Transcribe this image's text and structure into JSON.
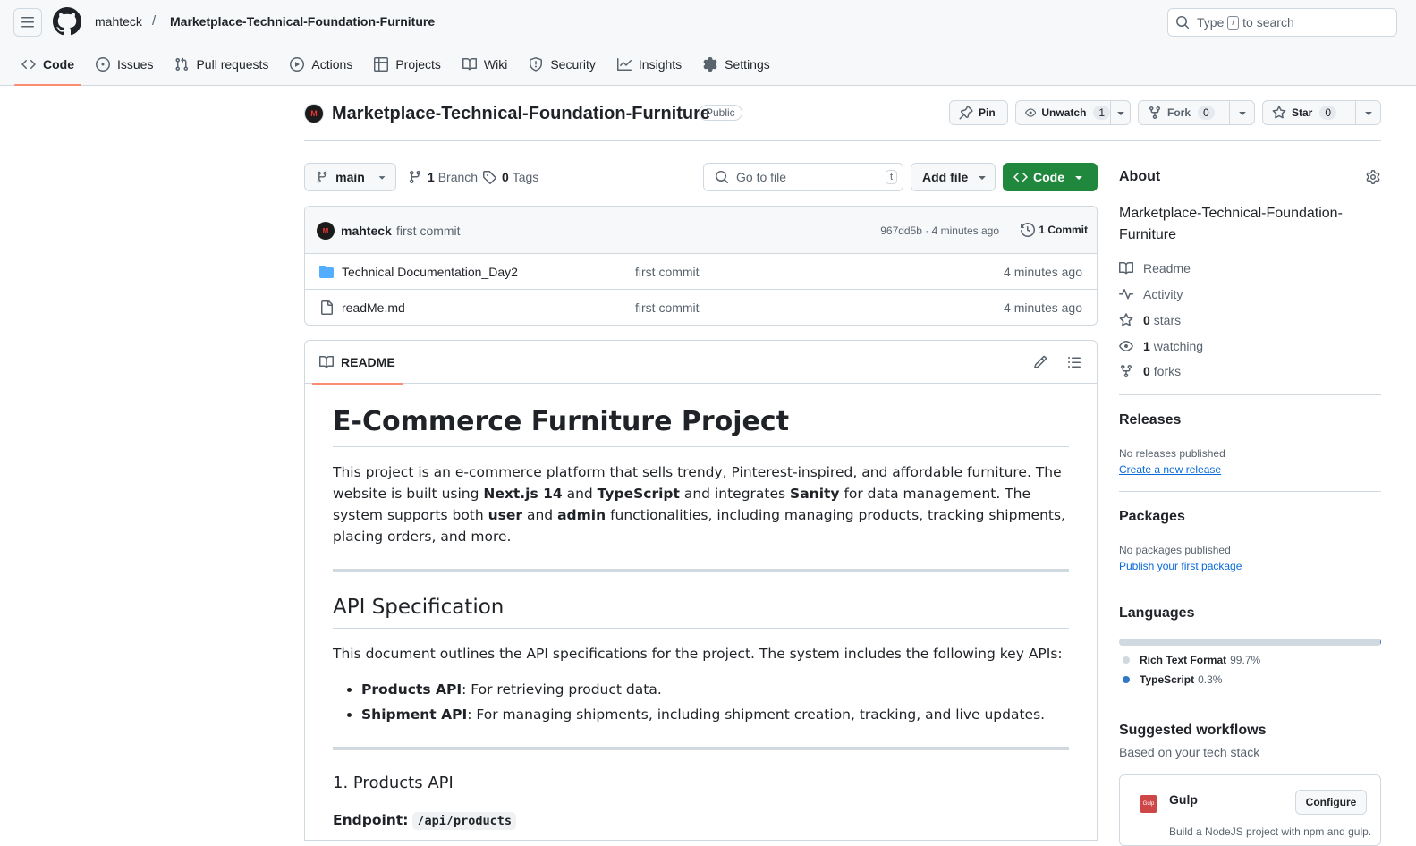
{
  "header": {
    "owner": "mahteck",
    "separator": "/",
    "repo": "Marketplace-Technical-Foundation-Furniture",
    "search_prefix": "Type",
    "search_key": "/",
    "search_suffix": "to search"
  },
  "nav_tabs": [
    {
      "label": "Code",
      "icon": "code-icon",
      "active": true
    },
    {
      "label": "Issues",
      "icon": "issue-icon"
    },
    {
      "label": "Pull requests",
      "icon": "pull-request-icon"
    },
    {
      "label": "Actions",
      "icon": "play-icon"
    },
    {
      "label": "Projects",
      "icon": "table-icon"
    },
    {
      "label": "Wiki",
      "icon": "book-icon"
    },
    {
      "label": "Security",
      "icon": "shield-icon"
    },
    {
      "label": "Insights",
      "icon": "graph-icon"
    },
    {
      "label": "Settings",
      "icon": "gear-icon"
    }
  ],
  "repo_head": {
    "avatar_text": "M",
    "title": "Marketplace-Technical-Foundation-Furniture",
    "visibility": "Public",
    "pin_label": "Pin",
    "unwatch_label": "Unwatch",
    "unwatch_count": "1",
    "fork_label": "Fork",
    "fork_count": "0",
    "star_label": "Star",
    "star_count": "0"
  },
  "toolbar": {
    "branch": "main",
    "branch_count": "1",
    "branch_label": "Branch",
    "tag_count": "0",
    "tag_label": "Tags",
    "goto_placeholder": "Go to file",
    "goto_key": "t",
    "add_file": "Add file",
    "code": "Code"
  },
  "commit": {
    "author": "mahteck",
    "message": "first commit",
    "hash_time": "967dd5b · 4 minutes ago",
    "count_label": "1 Commit"
  },
  "files": [
    {
      "name": "Technical Documentation_Day2",
      "type": "folder",
      "message": "first commit",
      "age": "4 minutes ago"
    },
    {
      "name": "readMe.md",
      "type": "file",
      "message": "first commit",
      "age": "4 minutes ago"
    }
  ],
  "readme": {
    "tab_label": "README",
    "h1": "E-Commerce Furniture Project",
    "intro_1": "This project is an e-commerce platform that sells trendy, Pinterest-inspired, and affordable furniture. The website is built using ",
    "intro_nextjs": "Next.js 14",
    "intro_2": " and ",
    "intro_ts": "TypeScript",
    "intro_3": " and integrates ",
    "intro_sanity": "Sanity",
    "intro_4": " for data management. The system supports both ",
    "intro_user": "user",
    "intro_5": " and ",
    "intro_admin": "admin",
    "intro_6": " functionalities, including managing products, tracking shipments, placing orders, and more.",
    "h2": "API Specification",
    "api_intro": "This document outlines the API specifications for the project. The system includes the following key APIs:",
    "list": [
      {
        "bold": "Products API",
        "text": ": For retrieving product data."
      },
      {
        "bold": "Shipment API",
        "text": ": For managing shipments, including shipment creation, tracking, and live updates."
      }
    ],
    "h3": "1. Products API",
    "endpoint_label": "Endpoint:",
    "endpoint_code": "/api/products"
  },
  "sidebar": {
    "about_title": "About",
    "description": "Marketplace-Technical-Foundation-Furniture",
    "links": [
      {
        "icon": "book-icon",
        "count": "",
        "label": "Readme"
      },
      {
        "icon": "pulse-icon",
        "count": "",
        "label": "Activity"
      },
      {
        "icon": "star-icon",
        "count": "0",
        "label": "stars"
      },
      {
        "icon": "eye-icon",
        "count": "1",
        "label": "watching"
      },
      {
        "icon": "fork-icon",
        "count": "0",
        "label": "forks"
      }
    ],
    "releases_title": "Releases",
    "releases_note": "No releases published",
    "releases_link": "Create a new release",
    "packages_title": "Packages",
    "packages_note": "No packages published",
    "packages_link": "Publish your first package",
    "languages_title": "Languages",
    "languages": [
      {
        "name": "Rich Text Format",
        "percent": "99.7%",
        "share": 99.7,
        "color": "#d1d9e0"
      },
      {
        "name": "TypeScript",
        "percent": "0.3%",
        "share": 0.3,
        "color": "#3178c6"
      }
    ],
    "workflows_title": "Suggested workflows",
    "workflows_sub": "Based on your tech stack",
    "workflow": {
      "name": "Gulp",
      "logo_text": "Gulp",
      "button": "Configure",
      "desc": "Build a NodeJS project with npm and gulp."
    }
  },
  "colors": {
    "accent": "#1f883d",
    "tab_underline": "#fd8c73",
    "link": "#0969da",
    "folder": "#54aeff"
  }
}
